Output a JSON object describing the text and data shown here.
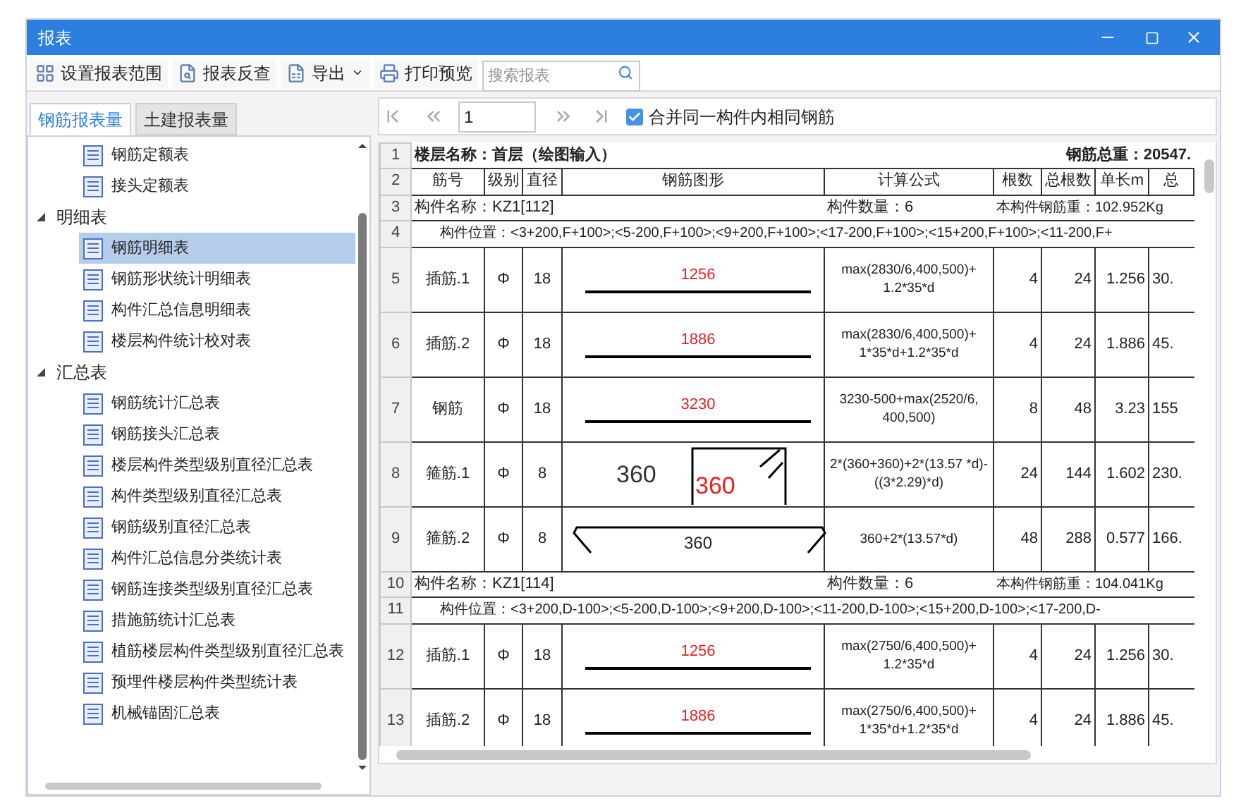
{
  "window": {
    "title": "报表"
  },
  "toolbar": [
    {
      "label": "设置报表范围"
    },
    {
      "label": "报表反查"
    },
    {
      "label": "导出",
      "dropdown": true
    },
    {
      "label": "打印预览"
    }
  ],
  "search": {
    "placeholder": "搜索报表"
  },
  "tabs": [
    {
      "label": "钢筋报表量",
      "selected": true
    },
    {
      "label": "土建报表量",
      "selected": false
    }
  ],
  "tree": [
    {
      "expanded": true,
      "children": [
        {
          "label": "钢筋定额表",
          "selected": false
        },
        {
          "label": "接头定额表",
          "selected": false
        }
      ]
    },
    {
      "label": "明细表",
      "expanded": true,
      "children": [
        {
          "label": "钢筋明细表",
          "selected": true
        },
        {
          "label": "钢筋形状统计明细表",
          "selected": false
        },
        {
          "label": "构件汇总信息明细表",
          "selected": false
        },
        {
          "label": "楼层构件统计校对表",
          "selected": false
        }
      ]
    },
    {
      "label": "汇总表",
      "expanded": true,
      "children": [
        {
          "label": "钢筋统计汇总表",
          "selected": false
        },
        {
          "label": "钢筋接头汇总表",
          "selected": false
        },
        {
          "label": "楼层构件类型级别直径汇总表",
          "selected": false
        },
        {
          "label": "构件类型级别直径汇总表",
          "selected": false
        },
        {
          "label": "钢筋级别直径汇总表",
          "selected": false
        },
        {
          "label": "构件汇总信息分类统计表",
          "selected": false
        },
        {
          "label": "钢筋连接类型级别直径汇总表",
          "selected": false
        },
        {
          "label": "措施筋统计汇总表",
          "selected": false
        },
        {
          "label": "植筋楼层构件类型级别直径汇总表",
          "selected": false
        },
        {
          "label": "预埋件楼层构件类型统计表",
          "selected": false
        },
        {
          "label": "机械锚固汇总表",
          "selected": false
        }
      ]
    }
  ],
  "pager": {
    "page": "1",
    "merge": {
      "label": "合并同一构件内相同钢筋",
      "checked": true
    }
  },
  "table": {
    "rows": [
      {
        "no": "1",
        "kind": "title",
        "left": "楼层名称：首层（绘图输入）",
        "right": "钢筋总重：20547."
      },
      {
        "no": "2",
        "kind": "header",
        "cells": [
          "筋号",
          "级别",
          "直径",
          "钢筋图形",
          "计算公式",
          "根数",
          "总根数",
          "单长m",
          "总"
        ]
      },
      {
        "no": "3",
        "kind": "component",
        "name": "构件名称：KZ1[112]",
        "count": "构件数量：6",
        "weight": "本构件钢筋重：102.952Kg"
      },
      {
        "no": "4",
        "kind": "position",
        "text": "构件位置：<3+200,F+100>;<5-200,F+100>;<9+200,F+100>;<17-200,F+100>;<15+200,F+100>;<11-200,F+"
      },
      {
        "no": "5",
        "kind": "bar",
        "cells": [
          "插筋.1",
          "Φ",
          "18"
        ],
        "shape": {
          "kind": "line",
          "labels": [
            "1256"
          ]
        },
        "formula": "max(2830/6,400,500)+ 1.2*35*d",
        "values": [
          "4",
          "24",
          "1.256",
          "30."
        ]
      },
      {
        "no": "6",
        "kind": "bar",
        "cells": [
          "插筋.2",
          "Φ",
          "18"
        ],
        "shape": {
          "kind": "line",
          "labels": [
            "1886"
          ]
        },
        "formula": "max(2830/6,400,500)+ 1*35*d+1.2*35*d",
        "values": [
          "4",
          "24",
          "1.886",
          "45."
        ]
      },
      {
        "no": "7",
        "kind": "bar",
        "cells": [
          "钢筋",
          "Φ",
          "18"
        ],
        "shape": {
          "kind": "line",
          "labels": [
            "3230"
          ]
        },
        "formula": "3230-500+max(2520/6, 400,500)",
        "values": [
          "8",
          "48",
          "3.23",
          "155"
        ]
      },
      {
        "no": "8",
        "kind": "bar",
        "cells": [
          "箍筋.1",
          "Φ",
          "8"
        ],
        "shape": {
          "kind": "stirrup",
          "labels": [
            "360",
            "360"
          ]
        },
        "formula": "2*(360+360)+2*(13.57 *d)-((3*2.29)*d)",
        "values": [
          "24",
          "144",
          "1.602",
          "230."
        ]
      },
      {
        "no": "9",
        "kind": "bar",
        "cells": [
          "箍筋.2",
          "Φ",
          "8"
        ],
        "shape": {
          "kind": "hook",
          "labels": [
            "360"
          ]
        },
        "formula": "360+2*(13.57*d)",
        "values": [
          "48",
          "288",
          "0.577",
          "166."
        ]
      },
      {
        "no": "10",
        "kind": "component",
        "name": "构件名称：KZ1[114]",
        "count": "构件数量：6",
        "weight": "本构件钢筋重：104.041Kg"
      },
      {
        "no": "11",
        "kind": "position",
        "text": "构件位置：<3+200,D-100>;<5-200,D-100>;<9+200,D-100>;<11-200,D-100>;<15+200,D-100>;<17-200,D-"
      },
      {
        "no": "12",
        "kind": "bar",
        "cells": [
          "插筋.1",
          "Φ",
          "18"
        ],
        "shape": {
          "kind": "line",
          "labels": [
            "1256"
          ]
        },
        "formula": "max(2750/6,400,500)+ 1.2*35*d",
        "values": [
          "4",
          "24",
          "1.256",
          "30."
        ]
      },
      {
        "no": "13",
        "kind": "bar",
        "cells": [
          "插筋.2",
          "Φ",
          "18"
        ],
        "shape": {
          "kind": "line",
          "labels": [
            "1886"
          ]
        },
        "formula": "max(2750/6,400,500)+ 1*35*d+1.2*35*d",
        "values": [
          "4",
          "24",
          "1.886",
          "45."
        ]
      }
    ]
  }
}
